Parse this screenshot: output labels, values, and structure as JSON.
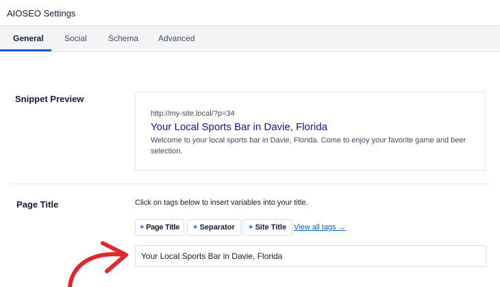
{
  "header": {
    "title": "AIOSEO Settings"
  },
  "tabs": [
    {
      "label": "General",
      "active": true
    },
    {
      "label": "Social"
    },
    {
      "label": "Schema"
    },
    {
      "label": "Advanced"
    }
  ],
  "snippet": {
    "label": "Snippet Preview",
    "url": "http://my-site.local/?p=34",
    "title": "Your Local Sports Bar in Davie, Florida",
    "description": "Welcome to your local sports bar in Davie, Florida. Come to enjoy your favorite game and beer selection."
  },
  "page_title": {
    "label": "Page Title",
    "instruction": "Click on tags below to insert variables into your title.",
    "tags": [
      {
        "label": "Page Title"
      },
      {
        "label": "Separator"
      },
      {
        "label": "Site Title"
      }
    ],
    "view_all": "View all tags →",
    "value": "Your Local Sports Bar in Davie, Florida"
  },
  "colors": {
    "accent": "#005ae0",
    "snippet_title": "#1a0dab",
    "annotation_arrow": "#e3262c"
  },
  "icons": {
    "plus": "plus-icon",
    "annotation": "red-curved-arrow"
  }
}
